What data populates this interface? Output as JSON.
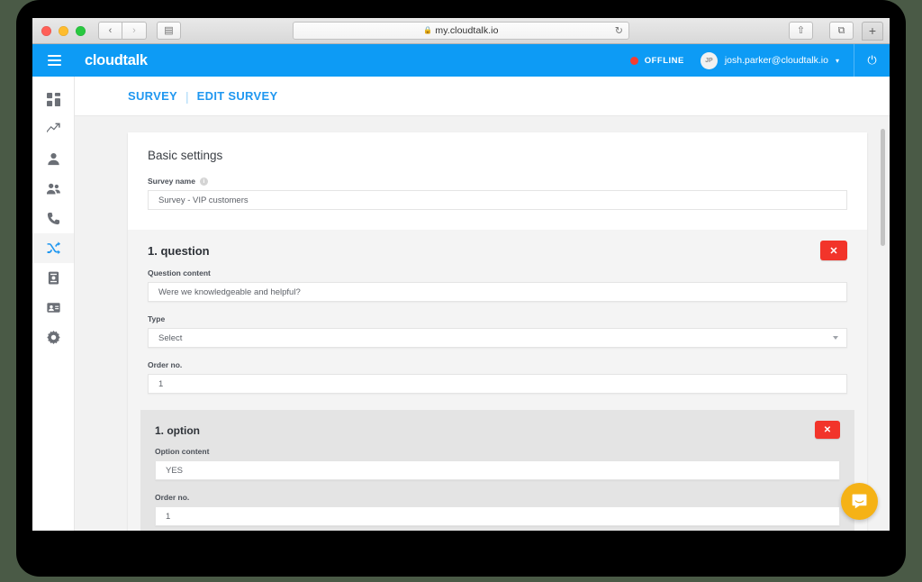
{
  "browser": {
    "url": "my.cloudtalk.io",
    "lock_icon": "lock-icon",
    "back_label": "‹",
    "forward_label": "›",
    "sidebar_toggle_label": "▤",
    "reload_label": "↻",
    "share_label": "⇧",
    "tabs_label": "⧉",
    "newtab_label": "+"
  },
  "appbar": {
    "brand": "cloudtalk",
    "status_label": "OFFLINE",
    "status_color": "#f43d32",
    "avatar_initials": "JP",
    "user_email": "josh.parker@cloudtalk.io",
    "caret": "▾",
    "power_label": "⏻",
    "accent_color": "#0d9bf5"
  },
  "sidebar": {
    "items": [
      {
        "name": "dashboard",
        "icon": "grid-icon",
        "active": false
      },
      {
        "name": "analytics",
        "icon": "trending-up-icon",
        "active": false
      },
      {
        "name": "agent",
        "icon": "user-icon",
        "active": false
      },
      {
        "name": "teams",
        "icon": "users-icon",
        "active": false
      },
      {
        "name": "calls",
        "icon": "phone-icon",
        "active": false
      },
      {
        "name": "routing",
        "icon": "shuffle-icon",
        "active": true
      },
      {
        "name": "voicemail",
        "icon": "archive-icon",
        "active": false
      },
      {
        "name": "contacts",
        "icon": "id-card-icon",
        "active": false
      },
      {
        "name": "settings",
        "icon": "gear-icon",
        "active": false
      }
    ]
  },
  "breadcrumb": {
    "parent": "SURVEY",
    "separator": "|",
    "current": "EDIT SURVEY"
  },
  "main": {
    "card_title": "Basic settings",
    "survey_name": {
      "label": "Survey name",
      "info_icon": "info-icon",
      "value": "Survey - VIP customers"
    },
    "question": {
      "heading": "1. question",
      "delete_label": "✕",
      "content": {
        "label": "Question content",
        "value": "Were we knowledgeable and helpful?"
      },
      "type": {
        "label": "Type",
        "value": "Select",
        "caret_icon": "chevron-down-icon"
      },
      "order": {
        "label": "Order no.",
        "value": "1"
      },
      "option": {
        "heading": "1. option",
        "delete_label": "✕",
        "content": {
          "label": "Option content",
          "value": "YES"
        },
        "order": {
          "label": "Order no.",
          "value": "1"
        }
      }
    }
  },
  "intercom": {
    "icon": "chat-bubble-icon",
    "color": "#f5b216"
  }
}
